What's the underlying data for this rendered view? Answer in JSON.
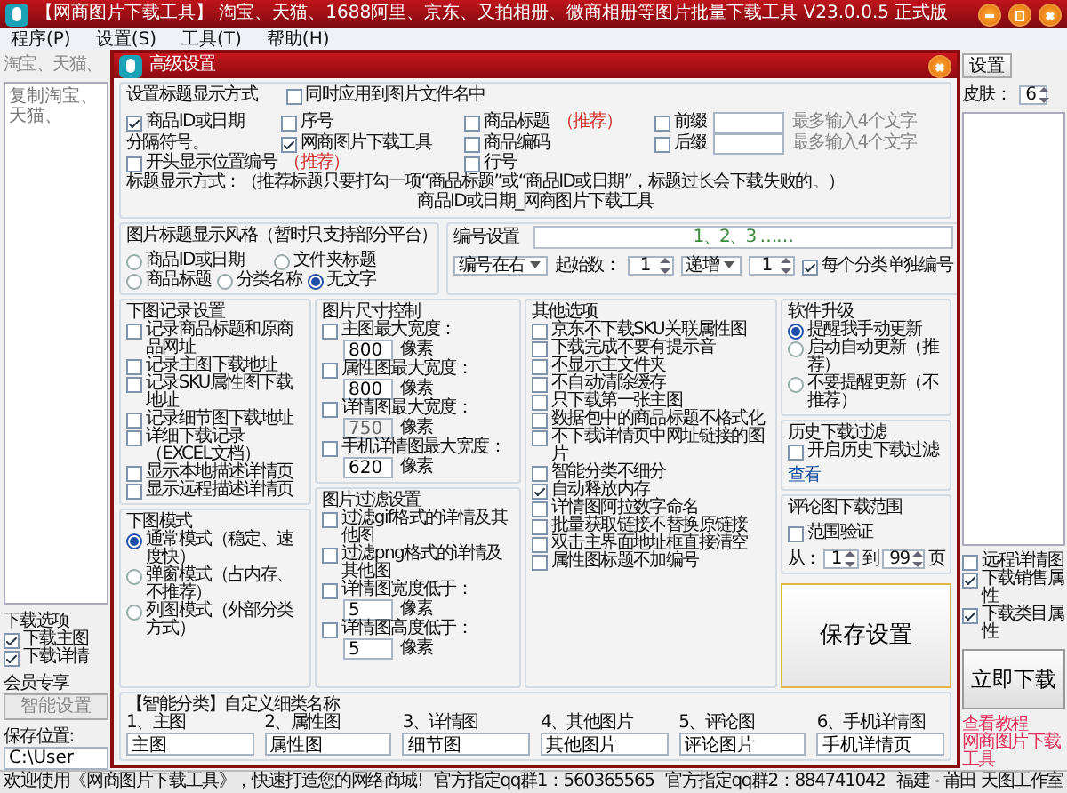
{
  "window": {
    "title": "【网商图片下载工具】 淘宝、天猫、1688阿里、京东、又拍相册、微商相册等图片批量下载工具 V23.0.0.5 正式版"
  },
  "menu": [
    {
      "label": "程序(P)"
    },
    {
      "label": "设置(S)"
    },
    {
      "label": "工具(T)"
    },
    {
      "label": "帮助(H)"
    }
  ],
  "main": {
    "banner": "淘宝、天猫、",
    "url_field": {
      "placeholder": "复制淘宝、天猫、"
    },
    "settings_button": "设置",
    "skin_label": "皮肤：",
    "skin_value": "6",
    "left_options": {
      "title": "下载选项",
      "items": [
        {
          "label": "下载主图",
          "checked": true
        },
        {
          "label": "下载详情",
          "checked": true
        }
      ]
    },
    "member": {
      "title": "会员专享",
      "button": "智能设置"
    },
    "save_path": {
      "label": "保存位置:",
      "value": "C:\\User"
    },
    "right_options": [
      {
        "label": "远程详情图",
        "checked": false
      },
      {
        "label": "下载销售属性",
        "checked": true
      },
      {
        "label": "下载类目属性",
        "checked": true
      }
    ],
    "download_button": "立即下载",
    "tutorial_link": "查看教程",
    "brand_link": "网商图片下载工具"
  },
  "dialog": {
    "title": "高级设置",
    "title_format": {
      "title": "设置标题显示方式",
      "apply_to_filename": {
        "label": "同时应用到图片文件名中",
        "checked": false
      },
      "rows": [
        [
          {
            "kind": "checkbox",
            "label": "商品ID或日期",
            "checked": true
          },
          {
            "kind": "checkbox",
            "label": "序号",
            "checked": false
          },
          {
            "kind": "checkbox",
            "label": "商品标题",
            "checked": false,
            "note": "（推荐）"
          },
          {
            "kind": "affix",
            "label": "前缀",
            "checked": false,
            "hint": "最多输入4个文字"
          }
        ],
        [
          {
            "kind": "text",
            "label": "分隔符号。"
          },
          {
            "kind": "checkbox",
            "label": "网商图片下载工具",
            "checked": true
          },
          {
            "kind": "checkbox",
            "label": "商品编码",
            "checked": false
          },
          {
            "kind": "affix",
            "label": "后缀",
            "checked": false,
            "hint": "最多输入4个文字"
          }
        ],
        [
          {
            "kind": "checkbox",
            "label": "开头显示位置编号",
            "checked": false,
            "note": "（推荐）"
          },
          "",
          {
            "kind": "checkbox",
            "label": "行号",
            "checked": false
          }
        ]
      ],
      "hint_text": "标题显示方式：（推荐标题只要打勾一项“商品标题”或“商品ID或日期”，标题过长会下载失败的。）",
      "preview": "商品ID或日期_网商图片下载工具"
    },
    "image_title_style": {
      "title": "图片标题显示风格（暂时只支持部分平台）",
      "options": [
        {
          "label": "商品ID或日期",
          "selected": false
        },
        {
          "label": "文件夹标题",
          "selected": false
        },
        {
          "label": "商品标题",
          "selected": false
        },
        {
          "label": "分类名称",
          "selected": false
        },
        {
          "label": "无文字",
          "selected": true
        }
      ]
    },
    "numbering": {
      "title": "编号设置",
      "preview": "1、2、3 ……",
      "position": "编号在右",
      "start_label": "起始数：",
      "start": "1",
      "order": "递增",
      "step": "1",
      "per_category": {
        "label": "每个分类单独编号",
        "checked": true
      }
    },
    "record_settings": {
      "title": "下图记录设置",
      "items": [
        {
          "label": "记录商品标题和原商品网址",
          "checked": false
        },
        {
          "label": "记录主图下载地址",
          "checked": false
        },
        {
          "label": "记录SKU属性图下载地址",
          "checked": false
        },
        {
          "label": "记录细节图下载地址",
          "checked": false
        },
        {
          "label": "详细下载记录（EXCEL文档）",
          "checked": false
        },
        {
          "label": "显示本地描述详情页",
          "checked": false
        },
        {
          "label": "显示远程描述详情页",
          "checked": false
        }
      ]
    },
    "download_mode": {
      "title": "下图模式",
      "options": [
        {
          "label": "通常模式（稳定、速度快）",
          "selected": true
        },
        {
          "label": "弹窗模式（占内存、不推荐）",
          "selected": false
        },
        {
          "label": "列图模式（外部分类方式）",
          "selected": false
        }
      ]
    },
    "size_control": {
      "title": "图片尺寸控制",
      "items": [
        {
          "label": "主图最大宽度：",
          "checked": false,
          "value": "800",
          "unit": "像素",
          "disabled": false
        },
        {
          "label": "属性图最大宽度：",
          "checked": false,
          "value": "800",
          "unit": "像素",
          "disabled": false
        },
        {
          "label": "详情图最大宽度：",
          "checked": false,
          "value": "750",
          "unit": "像素",
          "disabled": true
        },
        {
          "label": "手机详情图最大宽度：",
          "checked": false,
          "value": "620",
          "unit": "像素",
          "disabled": false
        }
      ]
    },
    "filter": {
      "title": "图片过滤设置",
      "items": [
        {
          "kind": "checkbox",
          "label": "过滤gif格式的详情及其他图",
          "checked": false
        },
        {
          "kind": "checkbox",
          "label": "过滤png格式的详情及其他图",
          "checked": false
        },
        {
          "kind": "number",
          "label": "详情图宽度低于：",
          "checked": false,
          "value": "5",
          "unit": "像素"
        },
        {
          "kind": "number",
          "label": "详情图高度低于：",
          "checked": false,
          "value": "5",
          "unit": "像素"
        }
      ]
    },
    "other_options": {
      "title": "其他选项",
      "items": [
        {
          "label": "京东不下载SKU关联属性图",
          "checked": false
        },
        {
          "label": "下载完成不要有提示音",
          "checked": false
        },
        {
          "label": "不显示主文件夹",
          "checked": false
        },
        {
          "label": "不自动清除缓存",
          "checked": false
        },
        {
          "label": "只下载第一张主图",
          "checked": false
        },
        {
          "label": "数据包中的商品标题不格式化",
          "checked": false
        },
        {
          "label": "不下载详情页中网址链接的图片",
          "checked": false
        },
        {
          "label": "智能分类不细分",
          "checked": false
        },
        {
          "label": "自动释放内存",
          "checked": true
        },
        {
          "label": "详情图阿拉数字命名",
          "checked": false
        },
        {
          "label": "批量获取链接不替换原链接",
          "checked": false
        },
        {
          "label": "双击主界面地址框直接清空",
          "checked": false
        },
        {
          "label": "属性图标题不加编号",
          "checked": false
        }
      ]
    },
    "update": {
      "title": "软件升级",
      "options": [
        {
          "label": "提醒我手动更新",
          "selected": true
        },
        {
          "label": "启动自动更新（推荐）",
          "selected": false
        },
        {
          "label": "不要提醒更新（不推荐）",
          "selected": false
        }
      ]
    },
    "history": {
      "title": "历史下载过滤",
      "enable": {
        "label": "开启历史下载过滤",
        "checked": false
      },
      "view_link": "查看"
    },
    "comment_range": {
      "title": "评论图下载范围",
      "verify": {
        "label": "范围验证",
        "checked": false
      },
      "from_label": "从：",
      "from": "1",
      "to_label": "到",
      "to": "99",
      "unit": "页"
    },
    "save_button": "保存设置",
    "categories": {
      "title": "【智能分类】自定义细类名称",
      "items": [
        {
          "label": "1、主图",
          "value": "主图"
        },
        {
          "label": "2、属性图",
          "value": "属性图"
        },
        {
          "label": "3、详情图",
          "value": "细节图"
        },
        {
          "label": "4、其他图片",
          "value": "其他图片"
        },
        {
          "label": "5、评论图",
          "value": "评论图片"
        },
        {
          "label": "6、手机详情图",
          "value": "手机详情页"
        }
      ]
    }
  },
  "status_bar": {
    "welcome": "欢迎使用《网商图片下载工具》，快速打造您的网络商城!",
    "qq_group_1": "官方指定qq群1：560365565",
    "qq_group_2": "官方指定qq群2：884741042",
    "studio": "福建 - 莆田 天图工作室"
  }
}
